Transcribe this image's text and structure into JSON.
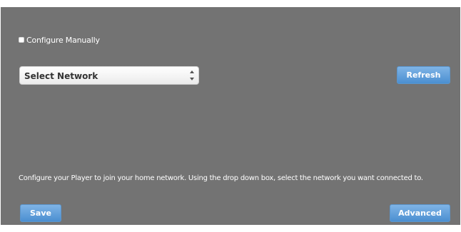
{
  "configure_manually": {
    "label": "Configure Manually",
    "checked": false
  },
  "network_select": {
    "selected": "Select Network"
  },
  "buttons": {
    "refresh": "Refresh",
    "save": "Save",
    "advanced": "Advanced"
  },
  "help_text": "Configure your Player to join your home network. Using the drop down box, select the network you want connected to.",
  "colors": {
    "panel_background": "#737373",
    "button_blue": "#5b9bd8"
  }
}
